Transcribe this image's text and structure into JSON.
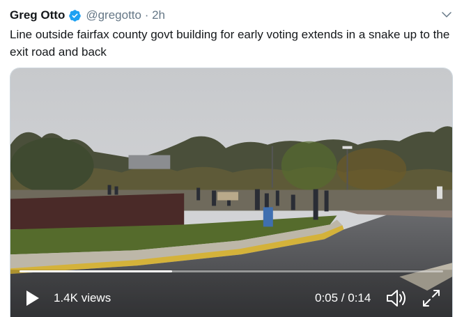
{
  "tweet": {
    "author_name": "Greg Otto",
    "handle_and_time": "@gregotto · 2h",
    "text": "Line outside fairfax county govt building for early voting extends in a snake up to the exit road and back"
  },
  "video": {
    "views": "1.4K views",
    "time": "0:05 / 0:14",
    "progress": 0.36
  },
  "icons": {
    "verified": "verified-badge-icon",
    "caret": "chevron-down-icon",
    "play": "play-icon",
    "volume": "volume-icon",
    "fullscreen": "fullscreen-icon"
  },
  "colors": {
    "verified_blue": "#1da1f2",
    "secondary_text": "#657786"
  }
}
